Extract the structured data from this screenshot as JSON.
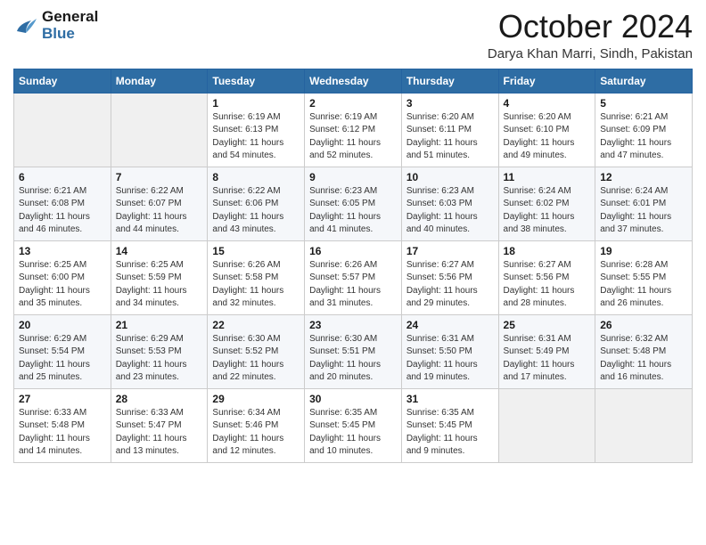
{
  "logo": {
    "line1": "General",
    "line2": "Blue"
  },
  "title": "October 2024",
  "subtitle": "Darya Khan Marri, Sindh, Pakistan",
  "days_of_week": [
    "Sunday",
    "Monday",
    "Tuesday",
    "Wednesday",
    "Thursday",
    "Friday",
    "Saturday"
  ],
  "weeks": [
    [
      {
        "day": "",
        "info": ""
      },
      {
        "day": "",
        "info": ""
      },
      {
        "day": "1",
        "info": "Sunrise: 6:19 AM\nSunset: 6:13 PM\nDaylight: 11 hours and 54 minutes."
      },
      {
        "day": "2",
        "info": "Sunrise: 6:19 AM\nSunset: 6:12 PM\nDaylight: 11 hours and 52 minutes."
      },
      {
        "day": "3",
        "info": "Sunrise: 6:20 AM\nSunset: 6:11 PM\nDaylight: 11 hours and 51 minutes."
      },
      {
        "day": "4",
        "info": "Sunrise: 6:20 AM\nSunset: 6:10 PM\nDaylight: 11 hours and 49 minutes."
      },
      {
        "day": "5",
        "info": "Sunrise: 6:21 AM\nSunset: 6:09 PM\nDaylight: 11 hours and 47 minutes."
      }
    ],
    [
      {
        "day": "6",
        "info": "Sunrise: 6:21 AM\nSunset: 6:08 PM\nDaylight: 11 hours and 46 minutes."
      },
      {
        "day": "7",
        "info": "Sunrise: 6:22 AM\nSunset: 6:07 PM\nDaylight: 11 hours and 44 minutes."
      },
      {
        "day": "8",
        "info": "Sunrise: 6:22 AM\nSunset: 6:06 PM\nDaylight: 11 hours and 43 minutes."
      },
      {
        "day": "9",
        "info": "Sunrise: 6:23 AM\nSunset: 6:05 PM\nDaylight: 11 hours and 41 minutes."
      },
      {
        "day": "10",
        "info": "Sunrise: 6:23 AM\nSunset: 6:03 PM\nDaylight: 11 hours and 40 minutes."
      },
      {
        "day": "11",
        "info": "Sunrise: 6:24 AM\nSunset: 6:02 PM\nDaylight: 11 hours and 38 minutes."
      },
      {
        "day": "12",
        "info": "Sunrise: 6:24 AM\nSunset: 6:01 PM\nDaylight: 11 hours and 37 minutes."
      }
    ],
    [
      {
        "day": "13",
        "info": "Sunrise: 6:25 AM\nSunset: 6:00 PM\nDaylight: 11 hours and 35 minutes."
      },
      {
        "day": "14",
        "info": "Sunrise: 6:25 AM\nSunset: 5:59 PM\nDaylight: 11 hours and 34 minutes."
      },
      {
        "day": "15",
        "info": "Sunrise: 6:26 AM\nSunset: 5:58 PM\nDaylight: 11 hours and 32 minutes."
      },
      {
        "day": "16",
        "info": "Sunrise: 6:26 AM\nSunset: 5:57 PM\nDaylight: 11 hours and 31 minutes."
      },
      {
        "day": "17",
        "info": "Sunrise: 6:27 AM\nSunset: 5:56 PM\nDaylight: 11 hours and 29 minutes."
      },
      {
        "day": "18",
        "info": "Sunrise: 6:27 AM\nSunset: 5:56 PM\nDaylight: 11 hours and 28 minutes."
      },
      {
        "day": "19",
        "info": "Sunrise: 6:28 AM\nSunset: 5:55 PM\nDaylight: 11 hours and 26 minutes."
      }
    ],
    [
      {
        "day": "20",
        "info": "Sunrise: 6:29 AM\nSunset: 5:54 PM\nDaylight: 11 hours and 25 minutes."
      },
      {
        "day": "21",
        "info": "Sunrise: 6:29 AM\nSunset: 5:53 PM\nDaylight: 11 hours and 23 minutes."
      },
      {
        "day": "22",
        "info": "Sunrise: 6:30 AM\nSunset: 5:52 PM\nDaylight: 11 hours and 22 minutes."
      },
      {
        "day": "23",
        "info": "Sunrise: 6:30 AM\nSunset: 5:51 PM\nDaylight: 11 hours and 20 minutes."
      },
      {
        "day": "24",
        "info": "Sunrise: 6:31 AM\nSunset: 5:50 PM\nDaylight: 11 hours and 19 minutes."
      },
      {
        "day": "25",
        "info": "Sunrise: 6:31 AM\nSunset: 5:49 PM\nDaylight: 11 hours and 17 minutes."
      },
      {
        "day": "26",
        "info": "Sunrise: 6:32 AM\nSunset: 5:48 PM\nDaylight: 11 hours and 16 minutes."
      }
    ],
    [
      {
        "day": "27",
        "info": "Sunrise: 6:33 AM\nSunset: 5:48 PM\nDaylight: 11 hours and 14 minutes."
      },
      {
        "day": "28",
        "info": "Sunrise: 6:33 AM\nSunset: 5:47 PM\nDaylight: 11 hours and 13 minutes."
      },
      {
        "day": "29",
        "info": "Sunrise: 6:34 AM\nSunset: 5:46 PM\nDaylight: 11 hours and 12 minutes."
      },
      {
        "day": "30",
        "info": "Sunrise: 6:35 AM\nSunset: 5:45 PM\nDaylight: 11 hours and 10 minutes."
      },
      {
        "day": "31",
        "info": "Sunrise: 6:35 AM\nSunset: 5:45 PM\nDaylight: 11 hours and 9 minutes."
      },
      {
        "day": "",
        "info": ""
      },
      {
        "day": "",
        "info": ""
      }
    ]
  ]
}
